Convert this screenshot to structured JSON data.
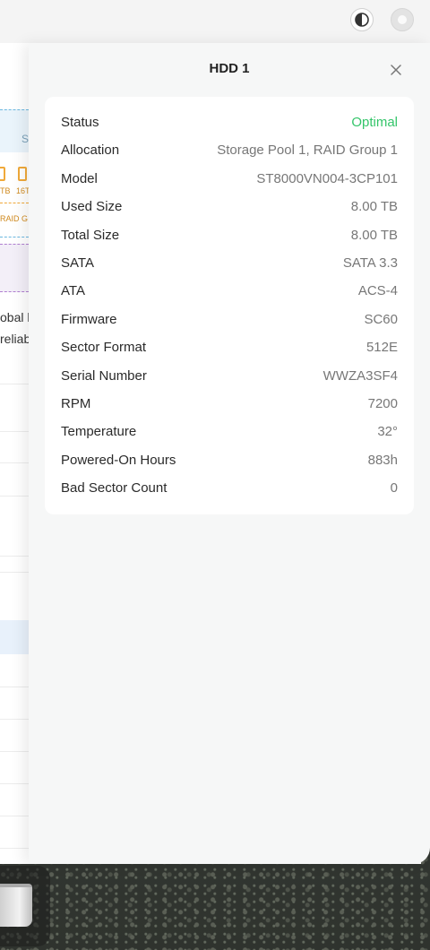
{
  "background_app": {
    "letter": "S",
    "tb_left": "TB",
    "tb_right": "16T",
    "raid_fragment": "RAID G",
    "text_line_1": "obal h",
    "text_line_2": "reliab"
  },
  "drawer": {
    "title": "HDD 1",
    "rows": [
      {
        "label": "Status",
        "value": "Optimal"
      },
      {
        "label": "Allocation",
        "value": "Storage Pool 1, RAID Group 1"
      },
      {
        "label": "Model",
        "value": "ST8000VN004-3CP101"
      },
      {
        "label": "Used Size",
        "value": "8.00 TB"
      },
      {
        "label": "Total Size",
        "value": "8.00 TB"
      },
      {
        "label": "SATA",
        "value": "SATA 3.3"
      },
      {
        "label": "ATA",
        "value": "ACS-4"
      },
      {
        "label": "Firmware",
        "value": "SC60"
      },
      {
        "label": "Sector Format",
        "value": "512E"
      },
      {
        "label": "Serial Number",
        "value": "WWZA3SF4"
      },
      {
        "label": "RPM",
        "value": "7200"
      },
      {
        "label": "Temperature",
        "value": "32°"
      },
      {
        "label": "Powered-On Hours",
        "value": "883h"
      },
      {
        "label": "Bad Sector Count",
        "value": "0"
      }
    ]
  },
  "icons": {
    "theme_toggle": "contrast-icon",
    "user": "avatar-icon",
    "close": "close-icon",
    "dock_item": "trash-icon"
  },
  "colors": {
    "status_ok": "#34c56a",
    "accent_orange": "#f0a93a",
    "accent_blue": "#6cb8e0"
  }
}
